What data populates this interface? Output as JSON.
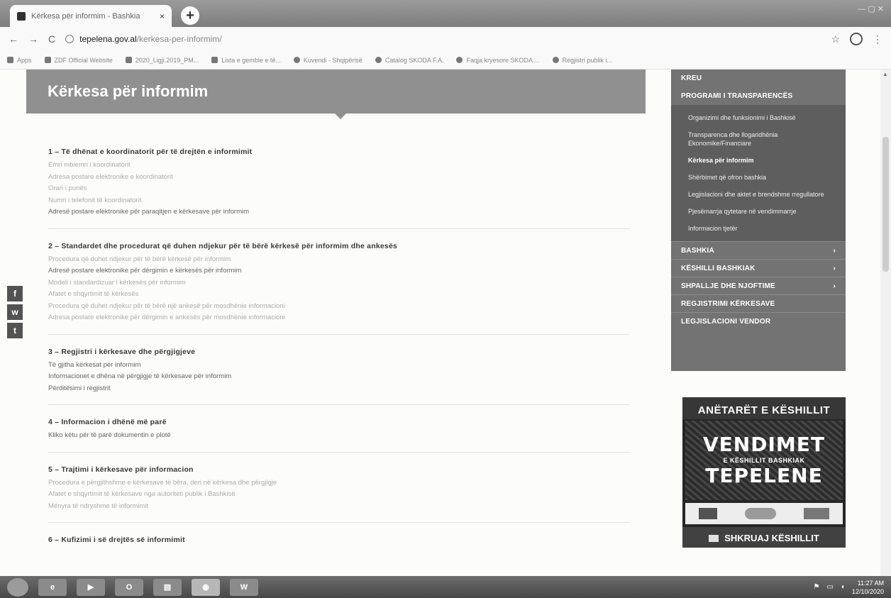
{
  "browser": {
    "tab_title": "Kërkesa për informim - Bashkia",
    "tab_close": "×",
    "new_tab": "+",
    "url_host": "tepelena.gov.al",
    "url_path": "/kerkesa-per-informim/",
    "back": "←",
    "forward": "→",
    "reload": "C",
    "star": "☆",
    "menu": "⋮",
    "window_controls": "— ▢ ✕",
    "bookmarks": [
      "Apps",
      "ZDF Official Website",
      "2020_Ligji.2019_PM...",
      "Lista e gemble e të...",
      "Kuvendi - Shqipërisë",
      "Catalog SKODA F.A.",
      "Faqja kryesore SKODA ...",
      "Regjistri publik i..."
    ]
  },
  "header": {
    "title": "Kërkesa për informim"
  },
  "sections": [
    {
      "title": "1 – Të dhënat e koordinatorit për të drejtën e informimit",
      "lines": [
        "Emri mbiemri i koordinatorit",
        "Adresa postare elektronike e koordinatorit",
        "Orari i punës",
        "Numri i telefonit të koordinatorit",
        "Adresë postare elektronike për paraqitjen e kërkesave për informim"
      ]
    },
    {
      "title": "2 – Standardet dhe procedurat që duhen ndjekur për të bërë kërkesë për informim dhe ankesës",
      "lines": [
        "Procedura që duhet ndjekur për të bërë kërkesë për informim",
        "Adresë postare elektronike për dërgimin e kërkesës për informim",
        "Modeli i standardizuar i kërkesës për informim",
        "Afatet e shqyrtimit të kërkesës",
        "Procedura që duhet ndjekur për të bërë një ankesë për mosdhënie informacioni",
        "Adresa postare elektronike për dërgimin e ankesës për mosdhënie informacioni"
      ]
    },
    {
      "title": "3 – Regjistri i kërkesave dhe përgjigjeve",
      "lines": [
        "Të gjitha kërkesat për informim",
        "Informacionet e dhëna në përgjigje të kërkesave për informim",
        "Përditësimi i regjistrit"
      ]
    },
    {
      "title": "4 – Informacion i dhënë më parë",
      "lines": [
        "Kliko këtu për të parë dokumentin e plotë"
      ]
    },
    {
      "title": "5 – Trajtimi i kërkesave për informacion",
      "lines": [
        "Procedura e përgjithshme e kërkesave të bëra, deri në kërkesa dhe përgjigje",
        "Afatet e shqyrtimit të kërkesave nga autoriteti publik i Bashkisë",
        "Mënyra të ndryshme të informimit"
      ]
    },
    {
      "title": "6 – Kufizimi i së drejtës së informimit",
      "lines": []
    }
  ],
  "sidebar": {
    "top": "KREU",
    "section_title": "PROGRAMI I TRANSPARENCËS",
    "subitems": [
      "Organizimi dhe funksionimi i Bashkisë",
      "Transparenca dhe llogaridhënia Ekonomike/Financiare",
      "Kërkesa për informim",
      "Shërbimet që ofron bashkia",
      "Legjislacioni dhe aktet e brendshme rregullatore",
      "Pjesëmarrja qytetare në vendimmarrje",
      "Informacion tjetër"
    ],
    "active_index": 2,
    "items": [
      {
        "label": "BASHKIA",
        "chev": "›"
      },
      {
        "label": "KËSHILLI BASHKIAK",
        "chev": "›"
      },
      {
        "label": "SHPALLJE DHE NJOFTIME",
        "chev": "›"
      },
      {
        "label": "REGJISTRIMI KËRKESAVE",
        "chev": ""
      },
      {
        "label": "LEGJISLACIONI VENDOR",
        "chev": ""
      }
    ]
  },
  "banner": {
    "head": "ANËTARËT E KËSHILLIT",
    "big1": "VENDIMET",
    "small": "E KËSHILLIT BASHKIAK",
    "big2": "TEPELENE",
    "write": "SHKRUAJ KËSHILLIT"
  },
  "social": [
    "f",
    "w",
    "t"
  ],
  "taskbar": {
    "time": "11:27 AM",
    "date": "12/10/2020"
  }
}
